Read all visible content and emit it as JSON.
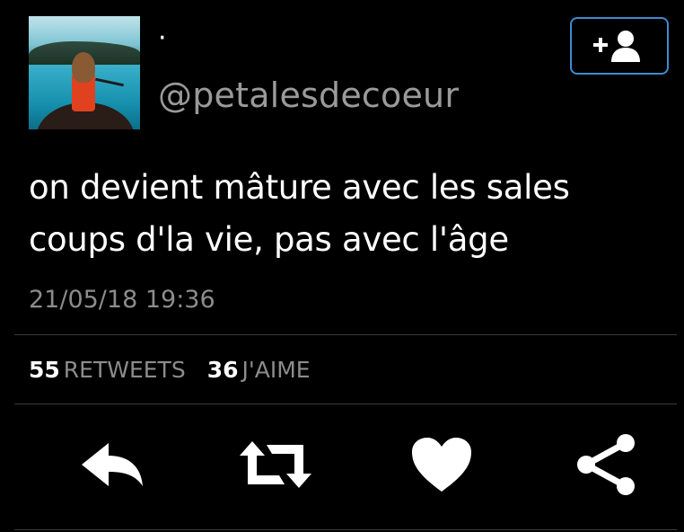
{
  "user": {
    "display_name": "·",
    "handle": "@petalesdecoeur"
  },
  "follow_button": {
    "icon": "add-user-icon",
    "accent": "#3b8ccf"
  },
  "tweet": {
    "text_line1": "on devient mâture avec les sales",
    "text_line2": "coups d'la vie, pas avec l'âge",
    "timestamp": "21/05/18 19:36"
  },
  "stats": {
    "retweets_count": "55",
    "retweets_label": "RETWEETS",
    "likes_count": "36",
    "likes_label": "J'AIME"
  },
  "actions": [
    {
      "name": "reply",
      "icon": "reply-icon"
    },
    {
      "name": "retweet",
      "icon": "retweet-icon"
    },
    {
      "name": "like",
      "icon": "heart-icon"
    },
    {
      "name": "share",
      "icon": "share-icon"
    }
  ]
}
